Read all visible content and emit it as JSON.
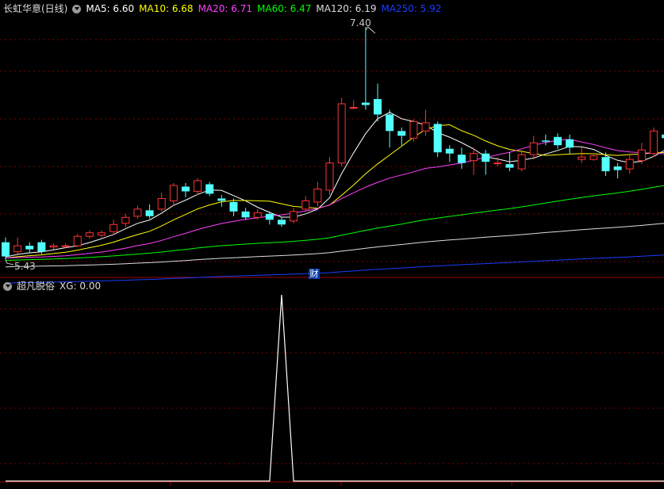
{
  "header": {
    "title": "长虹华意(日线)",
    "ma": [
      {
        "label": "MA5: 6.60",
        "color": "#ffffff"
      },
      {
        "label": "MA10: 6.68",
        "color": "#ffff00"
      },
      {
        "label": "MA20: 6.71",
        "color": "#ff40ff"
      },
      {
        "label": "MA60: 6.47",
        "color": "#00ff00"
      },
      {
        "label": "MA120: 6.19",
        "color": "#dcdcdc"
      },
      {
        "label": "MA250: 5.92",
        "color": "#1a3cff"
      }
    ]
  },
  "indicator": {
    "title": "超凡脱俗",
    "value_label": "XG: 0.00"
  },
  "annotations": {
    "high": "7.40",
    "low": "5.43",
    "event_badge": "财"
  },
  "colors": {
    "up": "#ff3232",
    "down": "#54ffff",
    "grid": "#800000",
    "axis": "#a00000"
  },
  "chart_data": {
    "type": "candlestick",
    "ylim": [
      5.35,
      7.48
    ],
    "candles": [
      [
        5.58,
        5.46,
        5.62,
        5.43
      ],
      [
        5.5,
        5.55,
        5.62,
        5.48
      ],
      [
        5.55,
        5.52,
        5.58,
        5.49
      ],
      [
        5.58,
        5.5,
        5.6,
        5.48
      ],
      [
        5.54,
        5.55,
        5.57,
        5.52
      ],
      [
        5.55,
        5.55,
        5.57,
        5.53
      ],
      [
        5.55,
        5.63,
        5.65,
        5.54
      ],
      [
        5.63,
        5.66,
        5.68,
        5.61
      ],
      [
        5.64,
        5.66,
        5.68,
        5.62
      ],
      [
        5.67,
        5.73,
        5.77,
        5.64
      ],
      [
        5.74,
        5.79,
        5.82,
        5.71
      ],
      [
        5.8,
        5.86,
        5.89,
        5.78
      ],
      [
        5.85,
        5.8,
        5.9,
        5.78
      ],
      [
        5.86,
        5.95,
        6.0,
        5.84
      ],
      [
        5.93,
        6.06,
        6.08,
        5.89
      ],
      [
        6.05,
        6.01,
        6.08,
        5.96
      ],
      [
        6.01,
        6.1,
        6.12,
        5.98
      ],
      [
        6.07,
        5.99,
        6.09,
        5.97
      ],
      [
        5.95,
        5.93,
        5.98,
        5.88
      ],
      [
        5.92,
        5.84,
        5.95,
        5.8
      ],
      [
        5.84,
        5.79,
        5.87,
        5.77
      ],
      [
        5.79,
        5.83,
        5.86,
        5.77
      ],
      [
        5.82,
        5.77,
        5.84,
        5.73
      ],
      [
        5.77,
        5.73,
        5.79,
        5.71
      ],
      [
        5.76,
        5.84,
        5.87,
        5.74
      ],
      [
        5.86,
        5.93,
        5.97,
        5.84
      ],
      [
        5.92,
        6.03,
        6.09,
        5.88
      ],
      [
        6.02,
        6.25,
        6.3,
        5.98
      ],
      [
        6.25,
        6.75,
        6.8,
        6.22
      ],
      [
        6.72,
        6.72,
        6.78,
        6.7
      ],
      [
        6.76,
        6.74,
        7.4,
        6.7
      ],
      [
        6.79,
        6.66,
        6.92,
        6.6
      ],
      [
        6.66,
        6.52,
        6.7,
        6.38
      ],
      [
        6.52,
        6.48,
        6.55,
        6.4
      ],
      [
        6.46,
        6.6,
        6.62,
        6.43
      ],
      [
        6.52,
        6.59,
        6.7,
        6.48
      ],
      [
        6.58,
        6.34,
        6.6,
        6.3
      ],
      [
        6.37,
        6.33,
        6.4,
        6.26
      ],
      [
        6.32,
        6.25,
        6.38,
        6.2
      ],
      [
        6.27,
        6.33,
        6.38,
        6.15
      ],
      [
        6.33,
        6.26,
        6.36,
        6.15
      ],
      [
        6.25,
        6.25,
        6.3,
        6.22
      ],
      [
        6.24,
        6.21,
        6.34,
        6.18
      ],
      [
        6.2,
        6.32,
        6.36,
        6.18
      ],
      [
        6.32,
        6.42,
        6.48,
        6.28
      ],
      [
        6.44,
        6.43,
        6.49,
        6.4
      ],
      [
        6.47,
        6.4,
        6.5,
        6.37
      ],
      [
        6.45,
        6.38,
        6.49,
        6.33
      ],
      [
        6.28,
        6.3,
        6.38,
        6.25
      ],
      [
        6.28,
        6.31,
        6.33,
        6.27
      ],
      [
        6.3,
        6.18,
        6.34,
        6.14
      ],
      [
        6.22,
        6.19,
        6.25,
        6.12
      ],
      [
        6.2,
        6.28,
        6.33,
        6.16
      ],
      [
        6.27,
        6.36,
        6.42,
        6.24
      ],
      [
        6.33,
        6.52,
        6.55,
        6.3
      ],
      [
        6.49,
        6.46,
        6.53,
        6.43
      ],
      [
        6.5,
        6.56,
        6.58,
        6.48
      ],
      [
        6.53,
        6.65,
        6.69,
        6.49
      ]
    ],
    "xg": [
      0,
      0,
      0,
      0,
      0,
      0,
      0,
      0,
      0,
      0,
      0,
      0,
      0,
      0,
      0,
      0,
      0,
      0,
      0,
      0,
      0,
      0,
      0,
      1,
      0,
      0,
      0,
      0,
      0,
      0,
      0,
      0,
      0,
      0,
      0,
      0,
      0,
      0,
      0,
      0,
      0,
      0,
      0,
      0,
      0,
      0,
      0,
      0,
      0,
      0,
      0,
      0,
      0,
      0,
      0,
      0,
      0,
      0
    ]
  }
}
